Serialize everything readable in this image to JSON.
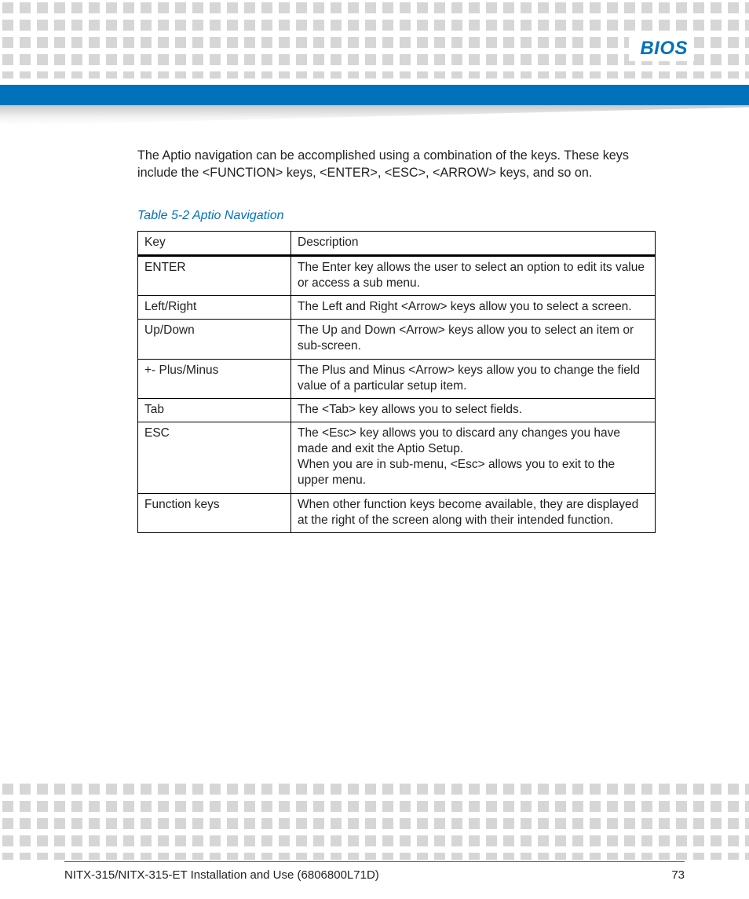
{
  "header": {
    "section_label": "BIOS"
  },
  "intro_text": "The Aptio navigation can be accomplished using a combination of the keys. These keys include the <FUNCTION> keys, <ENTER>, <ESC>, <ARROW> keys, and so on.",
  "table": {
    "caption": "Table 5-2 Aptio Navigation",
    "headers": {
      "col1": "Key",
      "col2": "Description"
    },
    "rows": [
      {
        "key": "ENTER",
        "desc": "The Enter key allows the user to select an option to edit its value or access a sub menu."
      },
      {
        "key": "Left/Right",
        "desc": "The Left and Right <Arrow> keys allow you to select a screen."
      },
      {
        "key": "Up/Down",
        "desc": "The Up and Down <Arrow> keys allow you to select an item or sub-screen."
      },
      {
        "key": "+- Plus/Minus",
        "desc": "The Plus and Minus <Arrow> keys allow you to change the field value of a particular setup item."
      },
      {
        "key": "Tab",
        "desc": "The <Tab> key allows you to select fields."
      },
      {
        "key": "ESC",
        "desc": "The <Esc> key allows you to discard any changes you have made and exit the Aptio Setup.\nWhen you are in sub-menu, <Esc> allows you to exit to the upper menu."
      },
      {
        "key": "Function keys",
        "desc": "When other function keys become available, they are displayed at the right of the screen along with their intended function."
      }
    ]
  },
  "footer": {
    "doc_title": "NITX-315/NITX-315-ET Installation and Use (6806800L71D)",
    "page_number": "73"
  }
}
